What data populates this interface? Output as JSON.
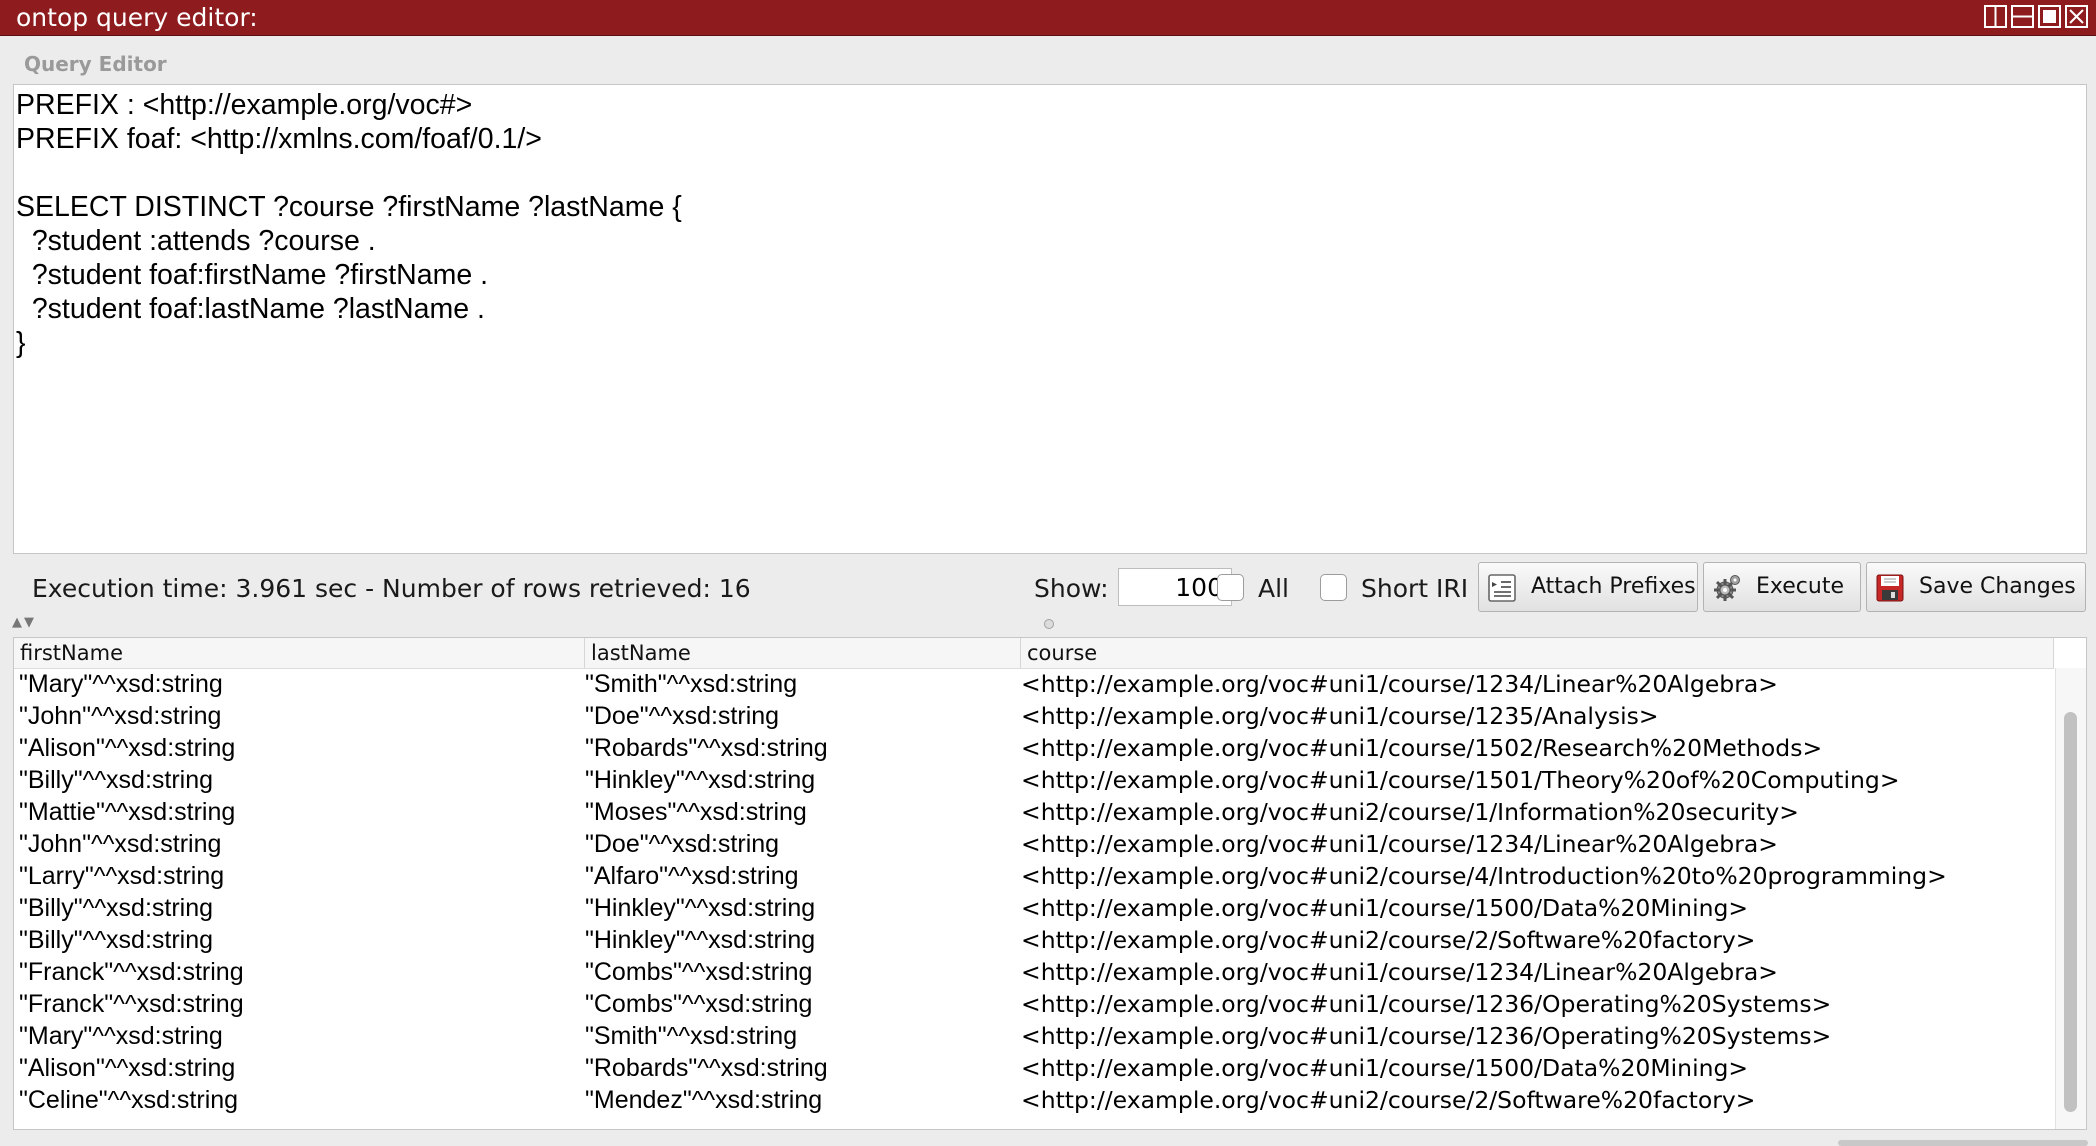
{
  "window": {
    "title": "ontop query editor:"
  },
  "query_editor": {
    "section_label": "Query Editor",
    "lines": [
      "PREFIX : <http://example.org/voc#>",
      "PREFIX foaf: <http://xmlns.com/foaf/0.1/>",
      "",
      "SELECT DISTINCT ?course ?firstName ?lastName {",
      "  ?student :attends ?course .",
      "  ?student foaf:firstName ?firstName .",
      "  ?student foaf:lastName ?lastName .",
      "}"
    ]
  },
  "toolbar": {
    "execution_info": "Execution time: 3.961 sec - Number of rows retrieved: 16",
    "show_label": "Show:",
    "show_value": "100",
    "all_label": "All",
    "all_checked": false,
    "short_iri_label": "Short IRI",
    "short_iri_checked": false,
    "attach_prefixes_label": "Attach Prefixes",
    "execute_label": "Execute",
    "save_changes_label": "Save Changes"
  },
  "results": {
    "columns": [
      "firstName",
      "lastName",
      "course"
    ],
    "rows": [
      [
        "\"Mary\"^^xsd:string",
        "\"Smith\"^^xsd:string",
        "<http://example.org/voc#uni1/course/1234/Linear%20Algebra>"
      ],
      [
        "\"John\"^^xsd:string",
        "\"Doe\"^^xsd:string",
        "<http://example.org/voc#uni1/course/1235/Analysis>"
      ],
      [
        "\"Alison\"^^xsd:string",
        "\"Robards\"^^xsd:string",
        "<http://example.org/voc#uni1/course/1502/Research%20Methods>"
      ],
      [
        "\"Billy\"^^xsd:string",
        "\"Hinkley\"^^xsd:string",
        "<http://example.org/voc#uni1/course/1501/Theory%20of%20Computing>"
      ],
      [
        "\"Mattie\"^^xsd:string",
        "\"Moses\"^^xsd:string",
        "<http://example.org/voc#uni2/course/1/Information%20security>"
      ],
      [
        "\"John\"^^xsd:string",
        "\"Doe\"^^xsd:string",
        "<http://example.org/voc#uni1/course/1234/Linear%20Algebra>"
      ],
      [
        "\"Larry\"^^xsd:string",
        "\"Alfaro\"^^xsd:string",
        "<http://example.org/voc#uni2/course/4/Introduction%20to%20programming>"
      ],
      [
        "\"Billy\"^^xsd:string",
        "\"Hinkley\"^^xsd:string",
        "<http://example.org/voc#uni1/course/1500/Data%20Mining>"
      ],
      [
        "\"Billy\"^^xsd:string",
        "\"Hinkley\"^^xsd:string",
        "<http://example.org/voc#uni2/course/2/Software%20factory>"
      ],
      [
        "\"Franck\"^^xsd:string",
        "\"Combs\"^^xsd:string",
        "<http://example.org/voc#uni1/course/1234/Linear%20Algebra>"
      ],
      [
        "\"Franck\"^^xsd:string",
        "\"Combs\"^^xsd:string",
        "<http://example.org/voc#uni1/course/1236/Operating%20Systems>"
      ],
      [
        "\"Mary\"^^xsd:string",
        "\"Smith\"^^xsd:string",
        "<http://example.org/voc#uni1/course/1236/Operating%20Systems>"
      ],
      [
        "\"Alison\"^^xsd:string",
        "\"Robards\"^^xsd:string",
        "<http://example.org/voc#uni1/course/1500/Data%20Mining>"
      ],
      [
        "\"Celine\"^^xsd:string",
        "\"Mendez\"^^xsd:string",
        "<http://example.org/voc#uni2/course/2/Software%20factory>"
      ]
    ]
  },
  "icons": {
    "window_controls": [
      "split-view-icon",
      "minimize-icon",
      "maximize-icon",
      "close-icon"
    ],
    "attach_prefixes": "attach-prefixes-icon",
    "execute": "gear-icon",
    "save_changes": "floppy-disk-icon"
  },
  "colors": {
    "title_bar": "#8e1b1e",
    "background": "#ececec"
  }
}
